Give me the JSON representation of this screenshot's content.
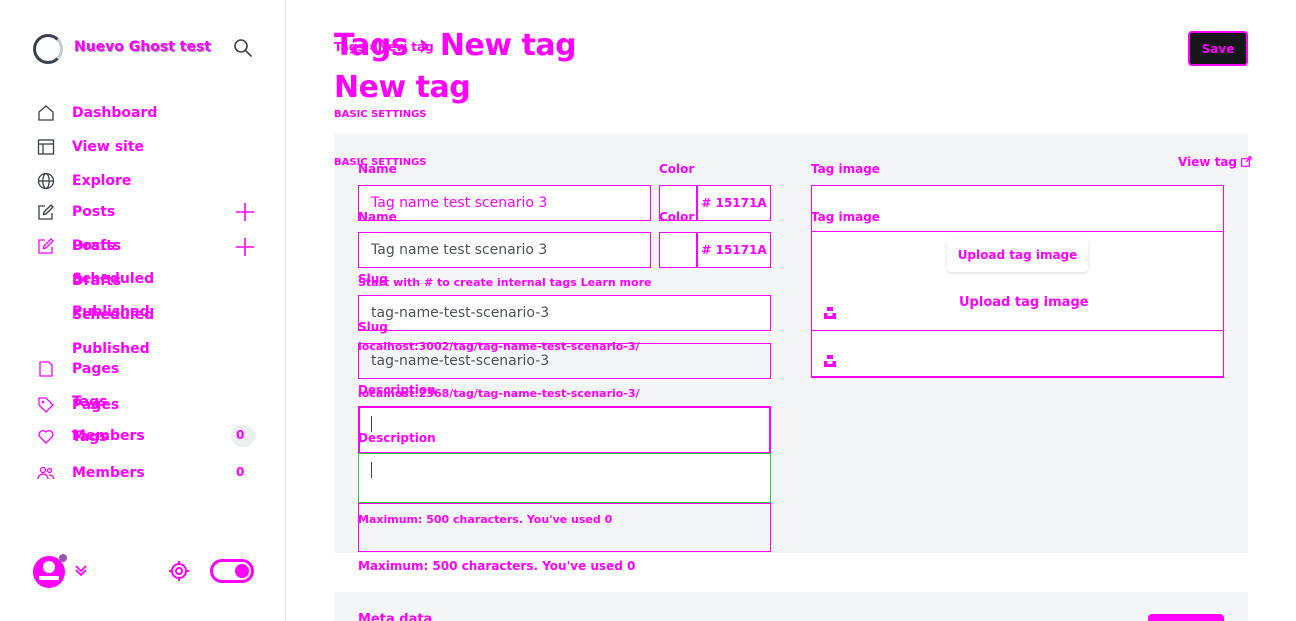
{
  "site": {
    "title": "Nuevo Ghost test"
  },
  "nav": {
    "dashboard": "Dashboard",
    "view_site": "View site",
    "explore": "Explore",
    "posts": "Posts",
    "drafts": "Drafts",
    "scheduled": "Scheduled",
    "published": "Published",
    "pages": "Pages",
    "tags": "Tags",
    "members": "Members",
    "members_count": "0"
  },
  "header": {
    "breadcrumb_parent": "Tags",
    "breadcrumb_sep": "›",
    "breadcrumb_current": "New tag",
    "title": "New tag",
    "title_overlay": "Tags › New tag",
    "save_label": "Save"
  },
  "form": {
    "section_label": "BASIC SETTINGS",
    "name_label": "Name",
    "name_value": "Tag name test scenario 3",
    "color_label": "Color",
    "color_hex": "# 15171A",
    "name_hint": "Start with # to create internal tags Learn more",
    "slug_label": "Slug",
    "slug_value": "tag-name-test-scenario-3",
    "slug_url_a": "localhost:3002/tag/tag-name-test-scenario-3/",
    "slug_url_b": "localhost:2368/tag/tag-name-test-scenario-3/",
    "description_label": "Description",
    "description_hint": "Maximum: 500 characters. You've used 0",
    "tag_image_label": "Tag image",
    "upload_label": "Upload tag image",
    "view_tag_label": "View tag"
  },
  "meta": {
    "title": "Meta data"
  },
  "colors": {
    "accent": "#ff00ff",
    "save_bg": "#15171a",
    "panel_bg": "#f4f5f6",
    "focus": "#30cf43"
  }
}
